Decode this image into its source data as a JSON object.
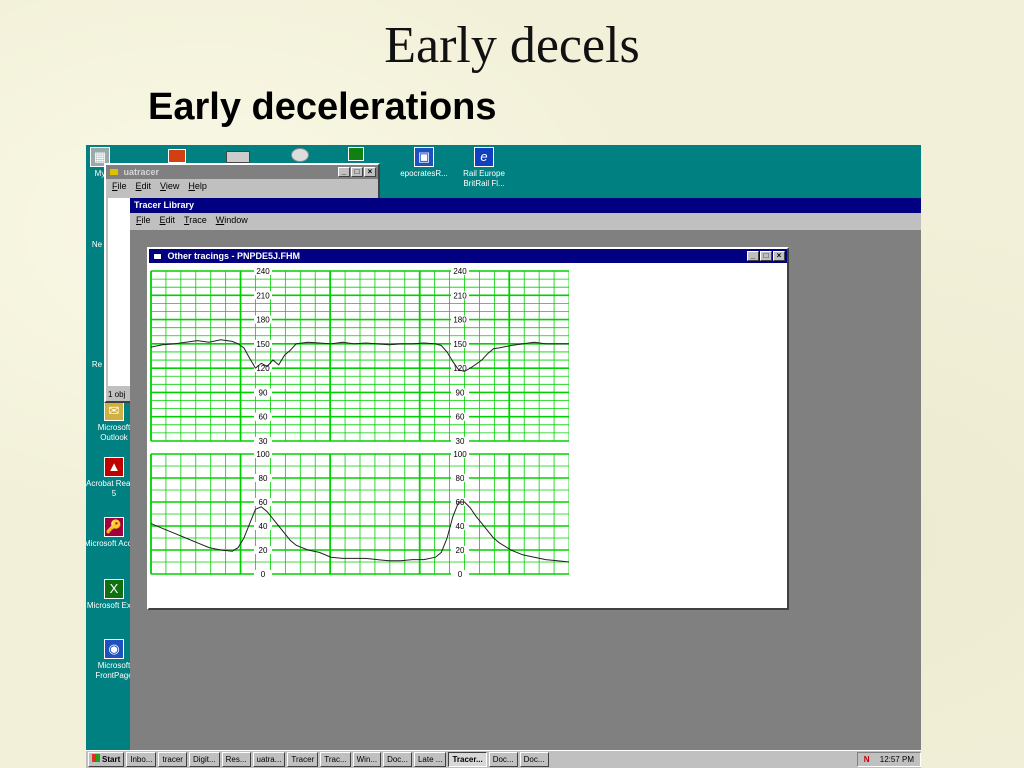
{
  "slide": {
    "title": "Early decels",
    "subtitle": "Early decelerations"
  },
  "desktop": {
    "icons": [
      {
        "label": "My",
        "icon": "computer-icon"
      },
      {
        "label": "epocratesR...",
        "icon": "epocrates-icon"
      },
      {
        "label": "Rail Europe BritRail Fl...",
        "icon": "internet-explorer-icon"
      },
      {
        "label": "Microsoft Outlook",
        "icon": "outlook-icon"
      },
      {
        "label": "Acrobat Reader 5",
        "icon": "acrobat-icon"
      },
      {
        "label": "Microsoft Access",
        "icon": "access-icon"
      },
      {
        "label": "Microsoft Excel",
        "icon": "excel-icon"
      },
      {
        "label": "Microsoft FrontPage",
        "icon": "frontpage-icon"
      },
      {
        "label": "Ne",
        "icon": "network-icon"
      },
      {
        "label": "Re",
        "icon": "recycle-bin-icon"
      }
    ]
  },
  "explorer_window": {
    "title": "uatracer",
    "menu": [
      "File",
      "Edit",
      "View",
      "Help"
    ],
    "status": "1 obj"
  },
  "tracer_window": {
    "title": "Tracer Library",
    "menu": [
      "File",
      "Edit",
      "Trace",
      "Window"
    ]
  },
  "tracing_window": {
    "title": "Other tracings - PNPDE5J.FHM"
  },
  "fhr_scale": [
    "240",
    "210",
    "180",
    "150",
    "120",
    "90",
    "60",
    "30"
  ],
  "toco_scale": [
    "100",
    "80",
    "60",
    "40",
    "20",
    "0"
  ],
  "chart_data": [
    {
      "type": "line",
      "name": "fetal heart rate",
      "ylim": [
        30,
        240
      ],
      "yticks": [
        240,
        210,
        180,
        150,
        120,
        90,
        60,
        30
      ],
      "x": [
        0,
        4,
        8,
        12,
        16,
        20,
        24,
        28,
        30,
        32,
        34,
        36,
        38,
        40,
        42,
        44,
        46,
        48,
        50,
        54,
        58,
        62,
        66,
        70,
        74,
        78,
        82,
        86,
        90,
        94,
        98,
        100,
        102,
        104,
        106,
        108,
        110,
        112,
        114,
        116,
        118,
        120,
        124,
        128,
        132,
        136,
        140,
        144
      ],
      "y": [
        146,
        149,
        150,
        152,
        154,
        152,
        155,
        153,
        150,
        145,
        132,
        120,
        126,
        122,
        130,
        124,
        136,
        142,
        150,
        152,
        151,
        150,
        152,
        150,
        151,
        150,
        149,
        150,
        150,
        151,
        150,
        148,
        140,
        128,
        118,
        116,
        120,
        125,
        130,
        138,
        144,
        145,
        148,
        150,
        152,
        150,
        150,
        150
      ]
    },
    {
      "type": "line",
      "name": "uterine contractions",
      "ylim": [
        0,
        100
      ],
      "yticks": [
        100,
        80,
        60,
        40,
        20,
        0
      ],
      "x": [
        0,
        4,
        8,
        12,
        16,
        20,
        24,
        28,
        30,
        32,
        34,
        36,
        38,
        40,
        42,
        44,
        46,
        48,
        50,
        54,
        58,
        62,
        66,
        70,
        74,
        78,
        82,
        86,
        90,
        94,
        98,
        100,
        102,
        104,
        106,
        108,
        110,
        112,
        114,
        116,
        118,
        120,
        124,
        128,
        132,
        136,
        140,
        144
      ],
      "y": [
        42,
        38,
        34,
        30,
        26,
        22,
        20,
        19,
        22,
        30,
        42,
        54,
        56,
        52,
        46,
        40,
        34,
        28,
        24,
        20,
        18,
        14,
        13,
        13,
        13,
        12,
        11,
        11,
        12,
        12,
        14,
        18,
        30,
        48,
        60,
        60,
        55,
        48,
        42,
        36,
        30,
        26,
        20,
        16,
        14,
        12,
        11,
        10
      ]
    }
  ],
  "taskbar": {
    "items": [
      "Start",
      "Inbo...",
      "tracer",
      "Digit...",
      "Res...",
      "uatra...",
      "Tracer",
      "Trac...",
      "Win...",
      "Doc...",
      "Late ...",
      "Tracer...",
      "Doc...",
      "Doc..."
    ],
    "active_index": 11,
    "clock": "12:57 PM",
    "tray_icons": "N"
  },
  "colors": {
    "desktop": "#008080",
    "grid": "#00d000",
    "trace": "#202020",
    "titlebar": "#000080"
  }
}
